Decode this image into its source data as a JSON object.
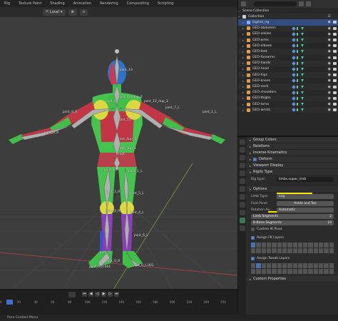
{
  "top_tabs": [
    "Rig",
    "Texture Paint",
    "Shading",
    "Animation",
    "Rendering",
    "Compositing",
    "Scripting"
  ],
  "viewport_header": {
    "transform_orientation": "Local"
  },
  "bone_labels": [
    {
      "text": "joint_13"
    },
    {
      "text": "joint_10_dup_2"
    },
    {
      "text": "joint_12_dup_3"
    },
    {
      "text": "joint_11"
    },
    {
      "text": "joint_9_R"
    },
    {
      "text": "joint_8_R"
    },
    {
      "text": "joint_7_L"
    },
    {
      "text": "joint_1_L"
    },
    {
      "text": "joint_12"
    },
    {
      "text": "root_dup_3"
    },
    {
      "text": "root_dup_1"
    },
    {
      "text": "root"
    },
    {
      "text": "joint_1_R"
    },
    {
      "text": "joint_1_L"
    },
    {
      "text": "joint_3_R"
    },
    {
      "text": "joint_5_L"
    },
    {
      "text": "joint_4_R"
    },
    {
      "text": "joint_4_L"
    },
    {
      "text": "joint_6_L"
    },
    {
      "text": "joint_5"
    },
    {
      "text": "joint_0_R"
    },
    {
      "text": "joint_0_R.001"
    },
    {
      "text": "joint_0_L.001"
    }
  ],
  "timeline": {
    "ruler": [
      "0",
      "20",
      "40",
      "60",
      "80",
      "100",
      "120",
      "140",
      "160",
      "180",
      "200",
      "220",
      "240",
      "250"
    ]
  },
  "status_bar": "Pose Context Menu",
  "outliner": {
    "scene_collection": "Scene Collection",
    "collection": "Collection",
    "rows": [
      {
        "name": "biginei_rig",
        "selected": true
      },
      {
        "name": "GEO-abdomen"
      },
      {
        "name": "GEO-ankles"
      },
      {
        "name": "GEO-arms"
      },
      {
        "name": "GEO-elbows"
      },
      {
        "name": "GEO-feet"
      },
      {
        "name": "GEO-forearms"
      },
      {
        "name": "GEO-hands"
      },
      {
        "name": "GEO-head"
      },
      {
        "name": "GEO-hips"
      },
      {
        "name": "GEO-knees"
      },
      {
        "name": "GEO-neck"
      },
      {
        "name": "GEO-shoulders"
      },
      {
        "name": "GEO-thighs"
      },
      {
        "name": "GEO-torso"
      },
      {
        "name": "GEO-wrists"
      }
    ]
  },
  "properties": {
    "group_colors": "Group Colors",
    "relations": "Relations",
    "inverse_kinematics": "Inverse Kinematics",
    "deform": "Deform",
    "viewport_display": "Viewport Display",
    "rigify_type": "Rigify Type",
    "rig_type_label": "Rig type:",
    "rig_type_value": "limbs.super_limb",
    "options": "Options",
    "limb_type_label": "Limb Type:",
    "limb_type_value": "Leg",
    "foot_pivot_label": "Foot Pivot:",
    "foot_pivot_value": "Ankle and Toe",
    "rotation_axis_label": "Rotation Ax...",
    "rotation_axis_value": "Automatic",
    "limb_segments_label": "Limb Segments",
    "limb_segments_value": "2",
    "bbone_segments_label": "B-Bone Segments",
    "bbone_segments_value": "10",
    "custom_ik_pivot": "Custom IK Pivot",
    "assign_fk_layers": "Assign FK Layers",
    "assign_tweak_layers": "Assign Tweak Layers",
    "custom_properties": "Custom Properties"
  },
  "colors": {
    "highlight": "#f5e700",
    "selection": "#334d80",
    "accent": "#4772b3"
  }
}
